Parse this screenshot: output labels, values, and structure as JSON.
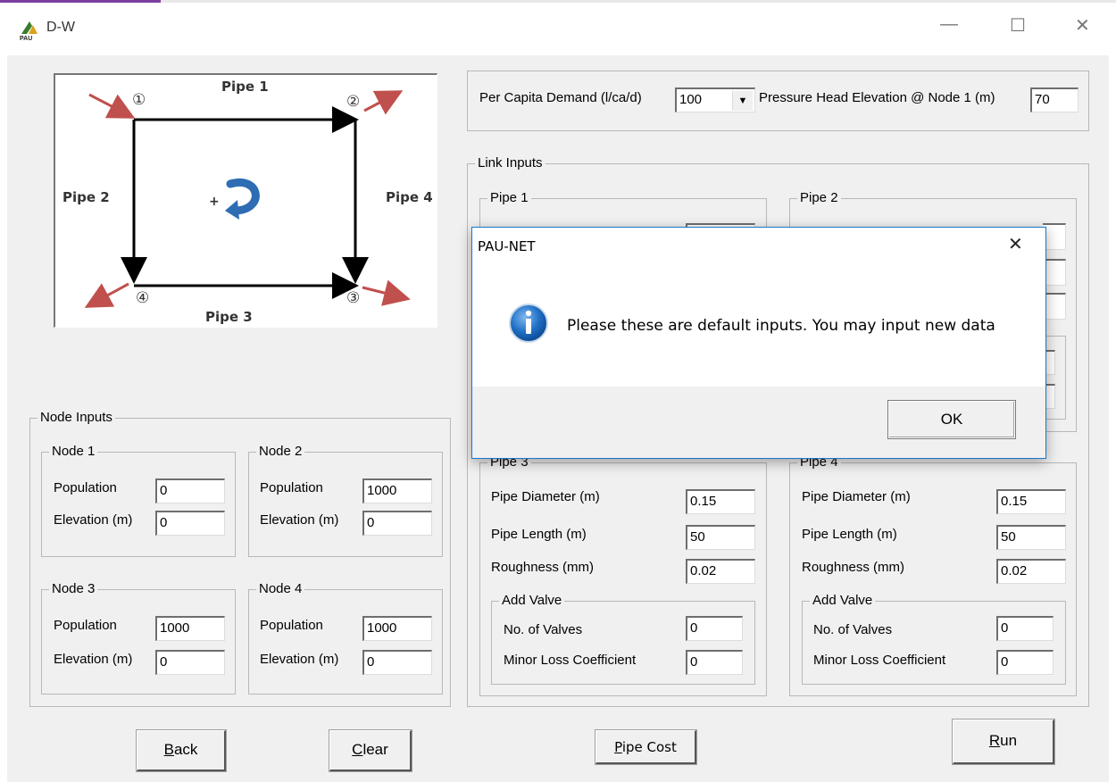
{
  "window": {
    "title": "D-W",
    "icon": "pau-logo-icon",
    "controls": {
      "minimize": "—",
      "maximize": "☐",
      "close": "✕"
    }
  },
  "diagram": {
    "pipe1": "Pipe 1",
    "pipe2": "Pipe 2",
    "pipe3": "Pipe 3",
    "pipe4": "Pipe 4",
    "node1": "①",
    "node2": "②",
    "node3": "③",
    "node4": "④",
    "plus": "+"
  },
  "top_inputs": {
    "per_capita_label": "Per Capita Demand (l/ca/d)",
    "per_capita_value": "100",
    "pressure_label": "Pressure Head Elevation @ Node 1 (m)",
    "pressure_value": "70"
  },
  "node_inputs": {
    "title": "Node Inputs",
    "population_label": "Population",
    "elevation_label": "Elevation (m)",
    "nodes": [
      {
        "title": "Node 1",
        "population": "0",
        "elevation": "0"
      },
      {
        "title": "Node 2",
        "population": "1000",
        "elevation": "0"
      },
      {
        "title": "Node 3",
        "population": "1000",
        "elevation": "0"
      },
      {
        "title": "Node 4",
        "population": "1000",
        "elevation": "0"
      }
    ]
  },
  "link_inputs": {
    "title": "Link Inputs",
    "diameter_label": "Pipe Diameter (m)",
    "length_label": "Pipe Length (m)",
    "roughness_label": "Roughness (mm)",
    "valve_title": "Add Valve",
    "valves_label": "No. of Valves",
    "minor_loss_label": "Minor Loss Coefficient",
    "pipes": [
      {
        "title": "Pipe 1"
      },
      {
        "title": "Pipe 2"
      },
      {
        "title": "Pipe 3",
        "diameter": "0.15",
        "length": "50",
        "roughness": "0.02",
        "valves": "0",
        "minor_loss": "0"
      },
      {
        "title": "Pipe 4",
        "diameter": "0.15",
        "length": "50",
        "roughness": "0.02",
        "valves": "0",
        "minor_loss": "0"
      }
    ]
  },
  "buttons": {
    "back_u": "B",
    "back_rest": "ack",
    "clear_u": "C",
    "clear_rest": "lear",
    "pipecost_u": "P",
    "pipecost_rest": "ipe Cost",
    "run_u": "R",
    "run_rest": "un"
  },
  "dialog": {
    "title": "PAU-NET",
    "message": "Please these are default inputs. You may input new data",
    "ok": "OK",
    "close": "✕",
    "icon": "info-icon"
  },
  "colors": {
    "dialog_border": "#1979ca",
    "info_blue": "#1f6fc5",
    "arrow_red": "#c0504d",
    "loop_blue": "#2e6db4"
  }
}
